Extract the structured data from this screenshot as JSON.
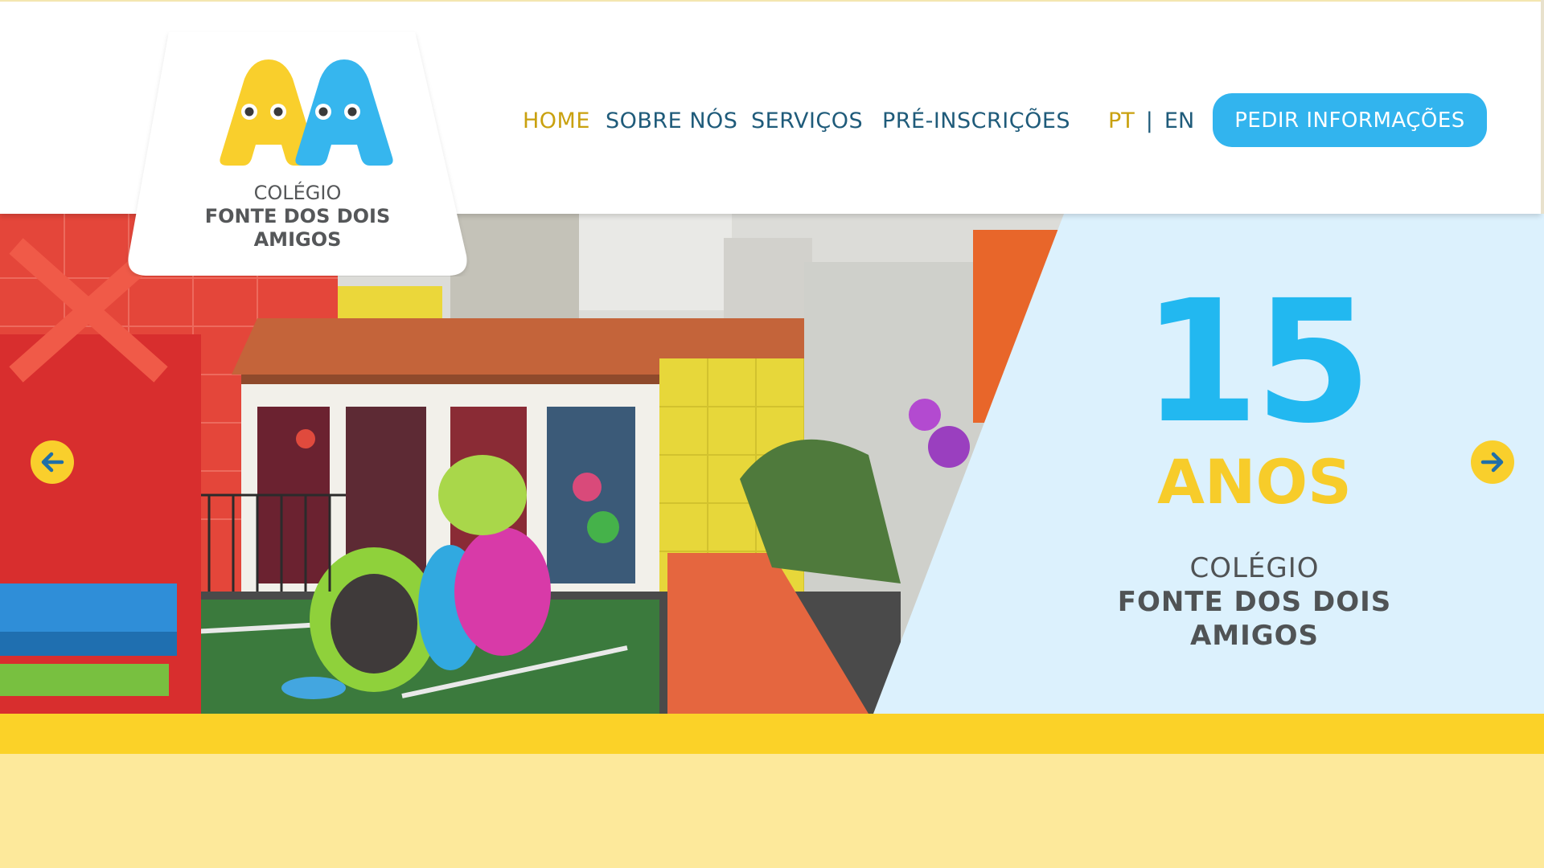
{
  "brand": {
    "logo_line1": "COLÉGIO",
    "logo_line2": "FONTE DOS DOIS",
    "logo_line3": "AMIGOS"
  },
  "nav": {
    "items": [
      {
        "label": "HOME",
        "active": true
      },
      {
        "label": "SOBRE NÓS",
        "active": false
      },
      {
        "label": "SERVIÇOS",
        "active": false
      },
      {
        "label": "PRÉ-INSCRIÇÕES",
        "active": false
      }
    ]
  },
  "language": {
    "current": "PT",
    "separator": "|",
    "other": "EN"
  },
  "cta": {
    "label": "PEDIR INFORMAÇÕES"
  },
  "hero": {
    "number": "15",
    "subtitle": "ANOS",
    "school_line1": "COLÉGIO",
    "school_line2": "FONTE DOS DOIS",
    "school_line3": "AMIGOS",
    "prev_icon": "arrow-left-icon",
    "next_icon": "arrow-right-icon"
  },
  "colors": {
    "accent_blue": "#32b4ee",
    "accent_yellow": "#fbd228",
    "nav_text": "#1f5b7a",
    "nav_active": "#c9a10f",
    "page_bg": "#fde99b",
    "hero_panel": "#dcf1fd"
  }
}
